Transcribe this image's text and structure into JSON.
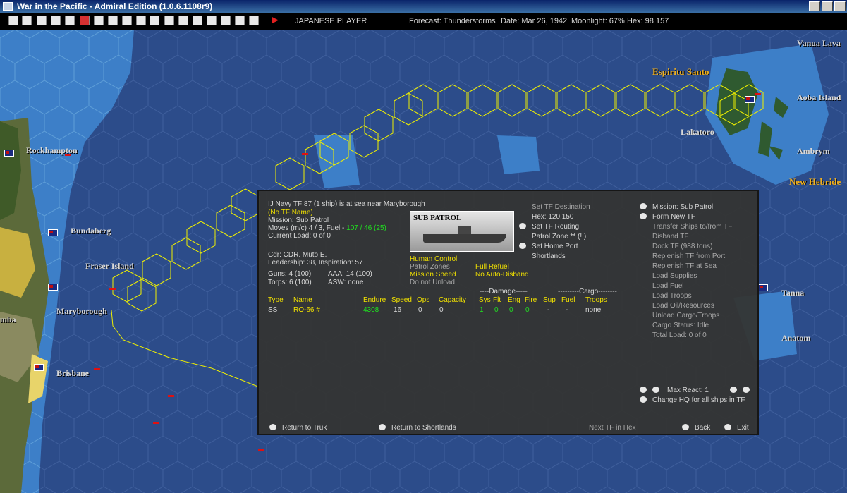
{
  "window": {
    "title": "War in the Pacific - Admiral Edition (1.0.6.1108r9)"
  },
  "toolbar": {
    "player": "JAPANESE PLAYER",
    "forecast": "Forecast: Thunderstorms",
    "date": "Date: Mar 26, 1942",
    "moonlight": "Moonlight: 67%",
    "hex": "Hex: 98 157"
  },
  "map": {
    "places": {
      "vanua_lava": "Vanua Lava",
      "espiritu_santo": "Espiritu Santo",
      "aoba_island": "Aoba Island",
      "lakatoro": "Lakatoro",
      "ambrym": "Ambrym",
      "new_hebrides": "New Hebride",
      "rockhampton": "Rockhampton",
      "bundaberg": "Bundaberg",
      "fraser_island": "Fraser Island",
      "maryborough": "Maryborough",
      "brisbane": "Brisbane",
      "mba": "mba",
      "tanna": "Tanna",
      "anatom": "Anatom"
    }
  },
  "tf": {
    "header": "IJ Navy TF 87 (1 ship) is at sea near Maryborough",
    "name": "(No TF Name)",
    "mission": "Mission: Sub Patrol",
    "moves_prefix": "Moves (m/c)  4 / 3, Fuel - ",
    "moves_fuel": "107 / 46 (25)",
    "current_load": "Current Load:  0 of 0",
    "cdr": "Cdr: CDR. Muto E.",
    "leadership": "Leadership: 38, Inspiration: 57",
    "guns": "Guns: 4 (100)",
    "aaa": "AAA: 14 (100)",
    "torps": "Torps: 6 (100)",
    "asw": "ASW: none",
    "image_caption": "SUB PATROL",
    "human_control": "Human Control",
    "patrol_zones": "Patrol Zones",
    "mission_speed": "Mission Speed",
    "do_not_unload": "Do not Unload",
    "full_refuel": "Full Refuel",
    "no_auto_disband": "No Auto-Disband"
  },
  "dest": {
    "set_tf_destination": "Set TF Destination",
    "hex": "Hex: 120,150",
    "set_tf_routing": "Set TF Routing",
    "patrol_zone": "Patrol Zone ** (!!)",
    "set_home_port": "Set Home Port",
    "shortlands": "Shortlands"
  },
  "table": {
    "damage_header": "----Damage-----",
    "cargo_header": "---------Cargo--------",
    "columns": {
      "type": "Type",
      "name": "Name",
      "endure": "Endure",
      "speed": "Speed",
      "ops": "Ops",
      "capacity": "Capacity",
      "sys": "Sys",
      "flt": "Flt",
      "eng": "Eng",
      "fire": "Fire",
      "sup": "Sup",
      "fuel": "Fuel",
      "troops": "Troops"
    },
    "row": {
      "type": "SS",
      "name": "RO-66 #",
      "endure": "4308",
      "speed": "16",
      "ops": "0",
      "capacity": "0",
      "sys": "1",
      "flt": "0",
      "eng": "0",
      "fire": "0",
      "sup": "-",
      "fuel": "-",
      "troops": "none"
    }
  },
  "commands": {
    "mission": "Mission: Sub Patrol",
    "form_new_tf": "Form New TF",
    "transfer_ships": "Transfer Ships to/from TF",
    "disband_tf": "Disband TF",
    "dock_tf": "Dock TF (988 tons)",
    "replenish_port": "Replenish TF from Port",
    "replenish_sea": "Replenish TF at Sea",
    "load_supplies": "Load Supplies",
    "load_fuel": "Load Fuel",
    "load_troops": "Load Troops",
    "load_oil": "Load Oil/Resources",
    "unload_cargo": "Unload Cargo/Troops",
    "cargo_status": "Cargo Status: Idle",
    "total_load": "Total Load: 0 of 0"
  },
  "react": {
    "max_react": "Max React:  1",
    "change_hq": "Change HQ for all ships in TF"
  },
  "footer": {
    "return_truk": "Return to Truk",
    "return_shortlands": "Return to Shortlands",
    "next_tf": "Next TF in Hex",
    "back": "Back",
    "exit": "Exit"
  }
}
